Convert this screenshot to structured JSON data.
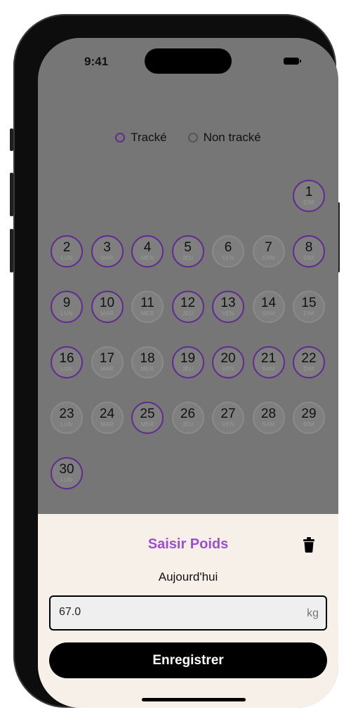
{
  "status_bar": {
    "time": "9:41"
  },
  "legend": {
    "tracked": "Tracké",
    "untracked": "Non tracké"
  },
  "calendar": {
    "leading_blanks": 6,
    "days": [
      {
        "num": "1",
        "dow": "DIM",
        "tracked": true
      },
      {
        "num": "2",
        "dow": "LUN",
        "tracked": true
      },
      {
        "num": "3",
        "dow": "MAR",
        "tracked": true
      },
      {
        "num": "4",
        "dow": "MER",
        "tracked": true
      },
      {
        "num": "5",
        "dow": "JEU",
        "tracked": true
      },
      {
        "num": "6",
        "dow": "VEN",
        "tracked": false
      },
      {
        "num": "7",
        "dow": "SAM",
        "tracked": false
      },
      {
        "num": "8",
        "dow": "DIM",
        "tracked": true
      },
      {
        "num": "9",
        "dow": "LUN",
        "tracked": true
      },
      {
        "num": "10",
        "dow": "MAR",
        "tracked": true
      },
      {
        "num": "11",
        "dow": "MER",
        "tracked": false
      },
      {
        "num": "12",
        "dow": "JEU",
        "tracked": true
      },
      {
        "num": "13",
        "dow": "VEN",
        "tracked": true
      },
      {
        "num": "14",
        "dow": "SAM",
        "tracked": false
      },
      {
        "num": "15",
        "dow": "DIM",
        "tracked": false
      },
      {
        "num": "16",
        "dow": "LUN",
        "tracked": true
      },
      {
        "num": "17",
        "dow": "MAR",
        "tracked": false
      },
      {
        "num": "18",
        "dow": "MER",
        "tracked": false
      },
      {
        "num": "19",
        "dow": "JEU",
        "tracked": true
      },
      {
        "num": "20",
        "dow": "VEN",
        "tracked": true
      },
      {
        "num": "21",
        "dow": "SAM",
        "tracked": true
      },
      {
        "num": "22",
        "dow": "DIM",
        "tracked": true
      },
      {
        "num": "23",
        "dow": "LUN",
        "tracked": false
      },
      {
        "num": "24",
        "dow": "MAR",
        "tracked": false
      },
      {
        "num": "25",
        "dow": "MER",
        "tracked": true
      },
      {
        "num": "26",
        "dow": "JEU",
        "tracked": false
      },
      {
        "num": "27",
        "dow": "VEN",
        "tracked": false
      },
      {
        "num": "28",
        "dow": "SAM",
        "tracked": false
      },
      {
        "num": "29",
        "dow": "DIM",
        "tracked": false
      },
      {
        "num": "30",
        "dow": "LUN",
        "tracked": true
      }
    ]
  },
  "sheet": {
    "title": "Saisir Poids",
    "date_label": "Aujourd'hui",
    "weight_value": "67.0",
    "unit": "kg",
    "save_label": "Enregistrer",
    "delete_icon": "trash-icon"
  },
  "colors": {
    "tracked_ring": "#5f2d8f",
    "untracked_ring": "#8a8a8a",
    "title_accent": "#9b4fce",
    "sheet_background": "#f7f0e8",
    "overlay": "#767676"
  }
}
